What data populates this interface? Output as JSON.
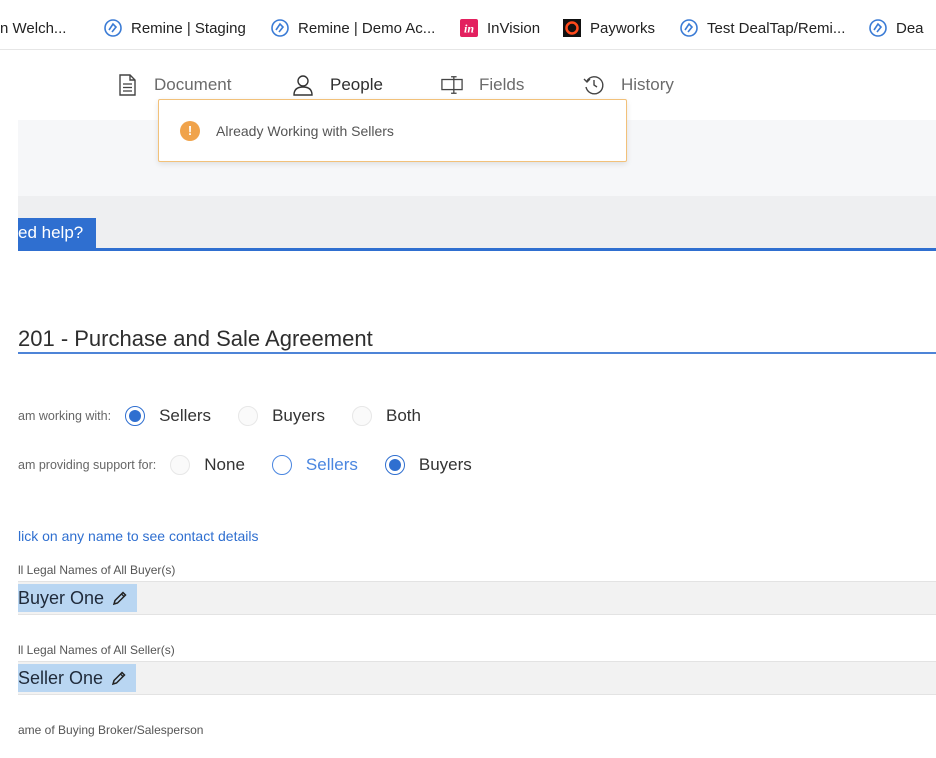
{
  "bookmarks": [
    {
      "label": "n Welch...",
      "icon": "none"
    },
    {
      "label": "Remine | Staging",
      "icon": "remine-icon"
    },
    {
      "label": "Remine | Demo Ac...",
      "icon": "remine-icon"
    },
    {
      "label": "InVision",
      "icon": "invision-icon"
    },
    {
      "label": "Payworks",
      "icon": "payworks-icon"
    },
    {
      "label": "Test DealTap/Remi...",
      "icon": "remine-icon"
    },
    {
      "label": "Dea",
      "icon": "remine-icon"
    }
  ],
  "nav": {
    "document": "Document",
    "people": "People",
    "fields": "Fields",
    "history": "History",
    "active": "people"
  },
  "toast": {
    "message": "Already Working with Sellers"
  },
  "help_tab": "ed help?",
  "document_title": "201 - Purchase and Sale Agreement",
  "working_with": {
    "label": "am working with:",
    "options": [
      "Sellers",
      "Buyers",
      "Both"
    ],
    "selected": "Sellers"
  },
  "providing_support": {
    "label": "am providing support for:",
    "options": [
      "None",
      "Sellers",
      "Buyers"
    ],
    "selected": "Buyers"
  },
  "contact_link": "lick on any name to see contact details",
  "buyers_field": {
    "label": "ll Legal Names of All Buyer(s)",
    "value": "Buyer One"
  },
  "sellers_field": {
    "label": "ll Legal Names of All Seller(s)",
    "value": "Seller One"
  },
  "broker_field": {
    "label": "ame of Buying Broker/Salesperson"
  },
  "colors": {
    "accent": "#2f6fd0",
    "warning": "#f0a34b",
    "chip": "#b9d6f2"
  }
}
